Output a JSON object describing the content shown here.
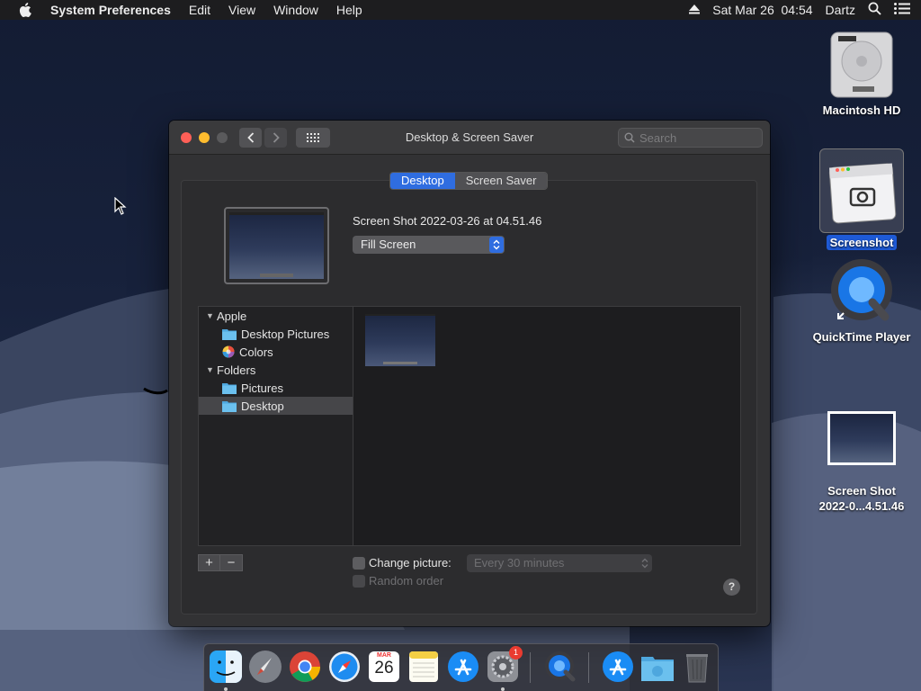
{
  "menubar": {
    "app_name": "System Preferences",
    "menus": [
      "Edit",
      "View",
      "Window",
      "Help"
    ],
    "clock": "Sat Mar 26  04:54",
    "user": "Dartz"
  },
  "desktop_icons": {
    "hd": "Macintosh HD",
    "screenshot_app": "Screenshot",
    "quicktime": "QuickTime Player",
    "file_line1": "Screen Shot",
    "file_line2": "2022-0...4.51.46"
  },
  "window": {
    "title": "Desktop & Screen Saver",
    "search_placeholder": "Search",
    "tabs": [
      "Desktop",
      "Screen Saver"
    ],
    "picture_name": "Screen Shot 2022-03-26 at 04.51.46",
    "fit_option": "Fill Screen",
    "sidebar": {
      "apple": "Apple",
      "desktop_pictures": "Desktop Pictures",
      "colors": "Colors",
      "folders": "Folders",
      "pictures": "Pictures",
      "desktop": "Desktop"
    },
    "add_label": "+",
    "remove_label": "−",
    "change_picture": "Change picture:",
    "interval": "Every 30 minutes",
    "random_order": "Random order",
    "help_label": "?"
  },
  "dock": {
    "calendar_month": "MAR",
    "calendar_day": "26",
    "badge_count": "1"
  },
  "colors": {
    "accent": "#2f6de0",
    "close": "#fe5f57",
    "minimize": "#febc2e"
  }
}
